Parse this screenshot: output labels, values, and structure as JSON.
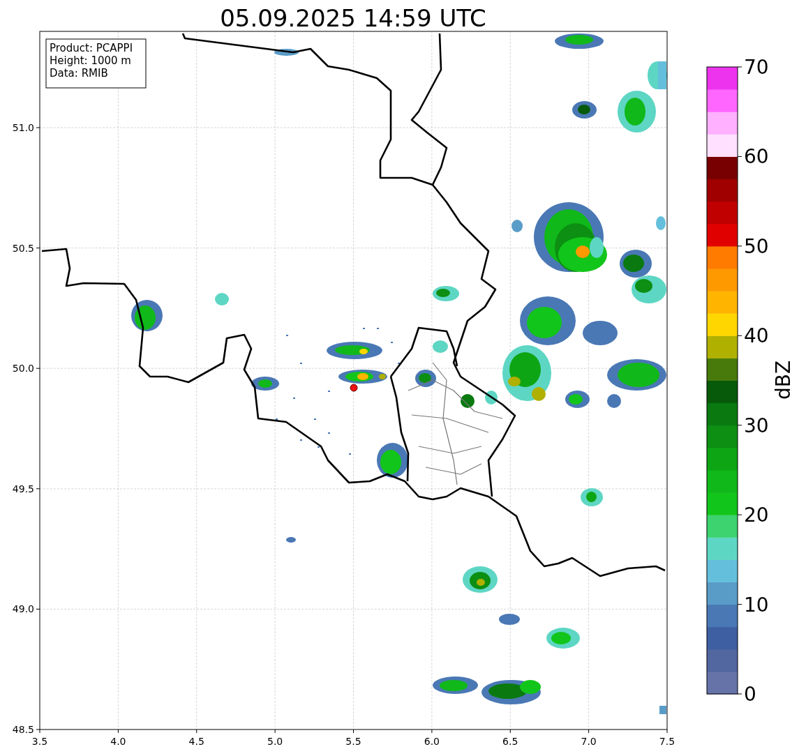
{
  "title": "05.09.2025 14:59 UTC",
  "map": {
    "info_box": [
      "Product: PCAPPI",
      "Height: 1000 m",
      "Data: RMIB"
    ],
    "xticks": [
      "3.5",
      "4.0",
      "4.5",
      "5.0",
      "5.5",
      "6.0",
      "6.5",
      "7.0",
      "7.5"
    ],
    "yticks": [
      "51.0",
      "50.5",
      "50.0",
      "49.5",
      "49.0",
      "48.5"
    ]
  },
  "colorbar": {
    "label": "dBZ",
    "ticks": [
      "70",
      "60",
      "50",
      "40",
      "30",
      "20",
      "10",
      "0"
    ],
    "bins": [
      {
        "color": "#6673a8"
      },
      {
        "color": "#5266a0"
      },
      {
        "color": "#3f5fa3"
      },
      {
        "color": "#4a78b5"
      },
      {
        "color": "#5a9cc8"
      },
      {
        "color": "#64bfdc"
      },
      {
        "color": "#5ed6c4"
      },
      {
        "color": "#3dd36e"
      },
      {
        "color": "#12c51a"
      },
      {
        "color": "#10b81a"
      },
      {
        "color": "#0ea514"
      },
      {
        "color": "#0c8f12"
      },
      {
        "color": "#0a7a10"
      },
      {
        "color": "#065a0a"
      },
      {
        "color": "#477a0a"
      },
      {
        "color": "#b0b000"
      },
      {
        "color": "#ffd600"
      },
      {
        "color": "#ffb400"
      },
      {
        "color": "#ff9900"
      },
      {
        "color": "#ff7b00"
      },
      {
        "color": "#e00000"
      },
      {
        "color": "#c00000"
      },
      {
        "color": "#a00000"
      },
      {
        "color": "#780000"
      },
      {
        "color": "#ffe0ff"
      },
      {
        "color": "#ffb0ff"
      },
      {
        "color": "#ff66ff"
      },
      {
        "color": "#ee33ee"
      }
    ]
  }
}
